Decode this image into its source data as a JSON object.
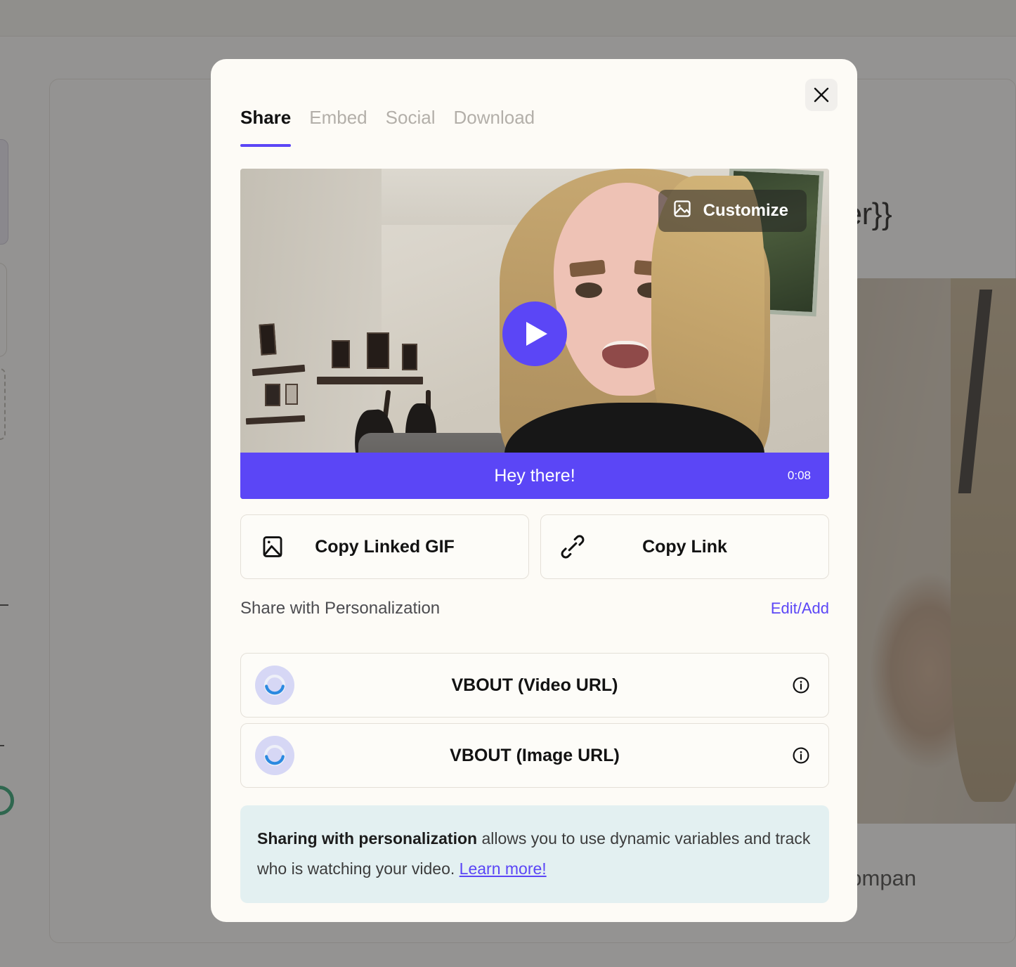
{
  "background": {
    "heading_text": "Partner}}",
    "body_text": "n help {{compan",
    "icons": {
      "sidebar_circle": "status-circle-icon"
    }
  },
  "modal": {
    "close_icon": "close-icon",
    "tabs": [
      {
        "label": "Share",
        "active": true
      },
      {
        "label": "Embed",
        "active": false
      },
      {
        "label": "Social",
        "active": false
      },
      {
        "label": "Download",
        "active": false
      }
    ],
    "video": {
      "customize_label": "Customize",
      "customize_icon": "image-icon",
      "play_icon": "play-icon",
      "caption_text": "Hey there!",
      "duration": "0:08"
    },
    "actions": [
      {
        "label": "Copy Linked GIF",
        "icon": "image-icon"
      },
      {
        "label": "Copy Link",
        "icon": "link-icon"
      }
    ],
    "personalization": {
      "title": "Share with Personalization",
      "edit_label": "Edit/Add",
      "rows": [
        {
          "label": "VBOUT (Video URL)",
          "logo": "vbout-logo-icon",
          "info_icon": "info-icon"
        },
        {
          "label": "VBOUT (Image URL)",
          "logo": "vbout-logo-icon",
          "info_icon": "info-icon"
        }
      ]
    },
    "banner": {
      "bold_text": "Sharing with personalization",
      "body_text": " allows you to use dynamic variables and track who is watching your video. ",
      "link_text": "Learn more!"
    }
  },
  "colors": {
    "accent_purple": "#5b46f6",
    "modal_bg": "#fdfbf6",
    "banner_bg": "#e3f0f1",
    "tab_inactive": "#b3afa9"
  }
}
